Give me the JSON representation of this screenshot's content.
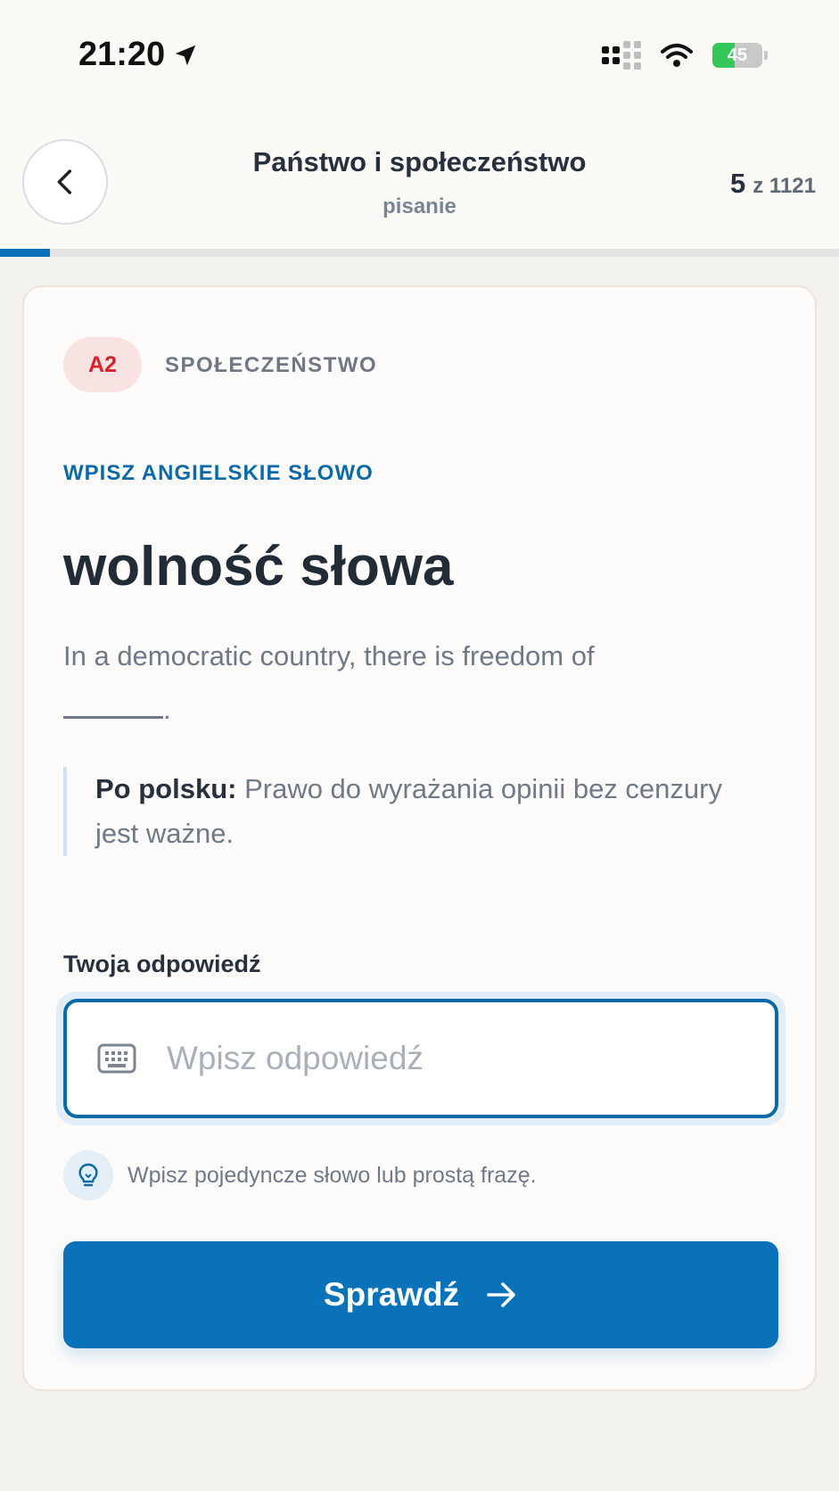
{
  "status_bar": {
    "time": "21:20",
    "battery": "45",
    "battery_level": 0.45
  },
  "header": {
    "title": "Państwo i społeczeństwo",
    "subtitle": "pisanie",
    "counter_current": "5",
    "counter_total": "z 1121",
    "progress_fraction": 0.06
  },
  "card": {
    "level": "A2",
    "category": "SPOŁECZEŃSTWO",
    "instruction": "WPISZ ANGIELSKIE SŁOWO",
    "word": "wolność słowa",
    "sentence": "In a democratic country, there is freedom of",
    "sentence_end": ".",
    "translation_label": "Po polsku:",
    "translation_text": "Prawo do wyrażania opinii bez cenzury jest ważne.",
    "answer_label": "Twoja odpowiedź",
    "input_placeholder": "Wpisz odpowiedź",
    "input_value": "",
    "hint": "Wpisz pojedyncze słowo lub prostą frazę.",
    "submit_label": "Sprawdź"
  },
  "colors": {
    "accent": "#0a72b8",
    "level_badge_bg": "#f9e2e2",
    "level_badge_text": "#d3262b"
  },
  "icons": [
    "location-arrow-icon",
    "cellular-signal-icon",
    "wifi-icon",
    "battery-icon",
    "chevron-left-icon",
    "keyboard-icon",
    "lightbulb-icon",
    "arrow-right-icon"
  ]
}
